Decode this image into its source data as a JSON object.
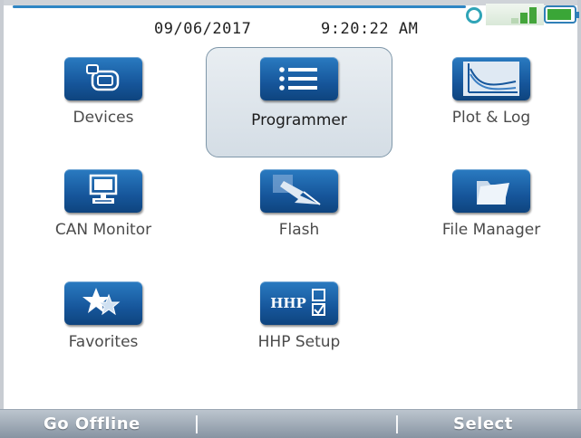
{
  "status": {
    "date": "09/06/2017",
    "time": "9:20:22 AM"
  },
  "menu": {
    "items": [
      {
        "label": "Devices",
        "icon": "devices-icon"
      },
      {
        "label": "Programmer",
        "icon": "list-icon",
        "selected": true
      },
      {
        "label": "Plot & Log",
        "icon": "chart-icon"
      },
      {
        "label": "CAN Monitor",
        "icon": "monitor-icon"
      },
      {
        "label": "Flash",
        "icon": "flash-icon"
      },
      {
        "label": "File Manager",
        "icon": "folder-icon"
      },
      {
        "label": "Favorites",
        "icon": "star-icon"
      },
      {
        "label": "HHP Setup",
        "icon": "hhp-setup-icon",
        "icon_text": "HHP"
      }
    ]
  },
  "softkeys": {
    "left": "Go Offline",
    "right": "Select"
  },
  "colors": {
    "icon_blue": "#16569b",
    "accent_line": "#2f86c4",
    "battery_green": "#3aa637",
    "selection_border": "#7f97a9"
  }
}
